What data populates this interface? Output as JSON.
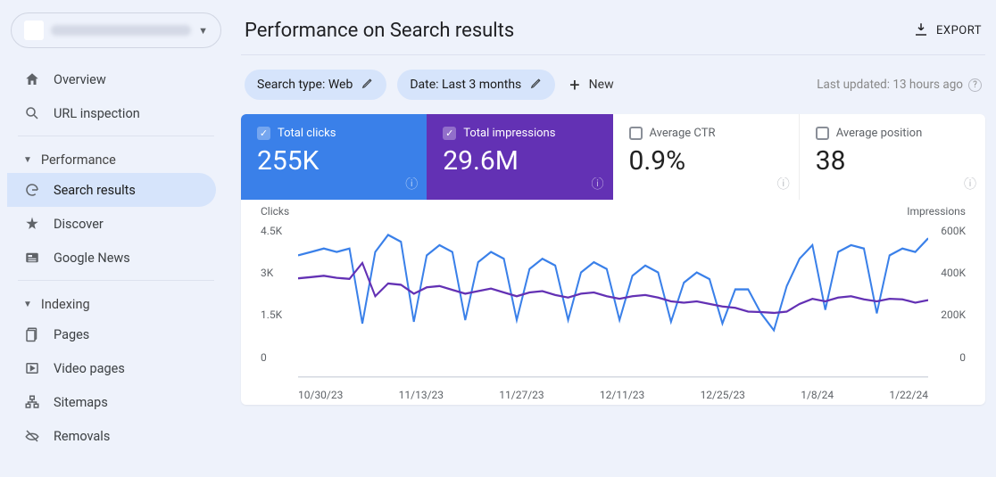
{
  "page_title": "Performance on Search results",
  "export_label": "EXPORT",
  "site_selector": {
    "open_label": "▼"
  },
  "sidebar": {
    "top": [
      {
        "label": "Overview",
        "icon": "home-icon"
      },
      {
        "label": "URL inspection",
        "icon": "search-icon"
      }
    ],
    "sections": [
      {
        "name": "Performance",
        "items": [
          {
            "label": "Search results",
            "icon": "google-icon",
            "active": true
          },
          {
            "label": "Discover",
            "icon": "star-icon"
          },
          {
            "label": "Google News",
            "icon": "news-icon"
          }
        ]
      },
      {
        "name": "Indexing",
        "items": [
          {
            "label": "Pages",
            "icon": "pages-icon"
          },
          {
            "label": "Video pages",
            "icon": "video-pages-icon"
          },
          {
            "label": "Sitemaps",
            "icon": "sitemaps-icon"
          },
          {
            "label": "Removals",
            "icon": "removals-icon"
          }
        ]
      }
    ]
  },
  "filters": {
    "search_type": "Search type: Web",
    "date": "Date: Last 3 months",
    "new_label": "New"
  },
  "last_updated": "Last updated: 13 hours ago",
  "metrics": {
    "clicks": {
      "label": "Total clicks",
      "value": "255K",
      "checked": true
    },
    "impressions": {
      "label": "Total impressions",
      "value": "29.6M",
      "checked": true
    },
    "ctr": {
      "label": "Average CTR",
      "value": "0.9%",
      "checked": false
    },
    "position": {
      "label": "Average position",
      "value": "38",
      "checked": false
    }
  },
  "chart_labels": {
    "left_title": "Clicks",
    "right_title": "Impressions",
    "left_ticks": [
      "4.5K",
      "3K",
      "1.5K",
      "0"
    ],
    "right_ticks": [
      "600K",
      "400K",
      "200K",
      "0"
    ],
    "x_ticks": [
      "10/30/23",
      "11/13/23",
      "11/27/23",
      "12/11/23",
      "12/25/23",
      "1/8/24",
      "1/22/24"
    ]
  },
  "chart_data": {
    "type": "line",
    "x": [
      "10/23/23",
      "10/25/23",
      "10/27/23",
      "10/29/23",
      "10/31/23",
      "11/02/23",
      "11/04/23",
      "11/06/23",
      "11/08/23",
      "11/10/23",
      "11/12/23",
      "11/14/23",
      "11/16/23",
      "11/18/23",
      "11/20/23",
      "11/22/23",
      "11/24/23",
      "11/26/23",
      "11/28/23",
      "11/30/23",
      "12/02/23",
      "12/04/23",
      "12/06/23",
      "12/08/23",
      "12/10/23",
      "12/12/23",
      "12/14/23",
      "12/16/23",
      "12/18/23",
      "12/20/23",
      "12/22/23",
      "12/24/23",
      "12/26/23",
      "12/28/23",
      "12/30/23",
      "01/01/24",
      "01/03/24",
      "01/05/24",
      "01/07/24",
      "01/09/24",
      "01/11/24",
      "01/13/24",
      "01/15/24",
      "01/17/24",
      "01/19/24",
      "01/21/24",
      "01/23/24",
      "01/25/24",
      "01/27/24",
      "01/29/24"
    ],
    "series": [
      {
        "name": "Clicks",
        "axis": "left",
        "color": "#3a80e9",
        "ylim": [
          0,
          4500
        ],
        "values": [
          3600,
          3700,
          3800,
          3700,
          3800,
          1600,
          3700,
          4200,
          4000,
          1650,
          3600,
          3900,
          3700,
          1700,
          3400,
          3700,
          3500,
          1700,
          3200,
          3500,
          3300,
          1700,
          3100,
          3400,
          3200,
          1700,
          3000,
          3300,
          3100,
          1650,
          2800,
          3100,
          2900,
          1600,
          2600,
          2600,
          1900,
          1400,
          2700,
          3500,
          3900,
          2000,
          3700,
          3900,
          3800,
          1900,
          3600,
          3800,
          3700,
          4100
        ]
      },
      {
        "name": "Impressions",
        "axis": "right",
        "color": "#6331b4",
        "ylim": [
          0,
          600000
        ],
        "values": [
          390000,
          395000,
          400000,
          392000,
          388000,
          450000,
          320000,
          370000,
          365000,
          330000,
          355000,
          360000,
          345000,
          330000,
          340000,
          350000,
          335000,
          320000,
          335000,
          340000,
          325000,
          315000,
          330000,
          335000,
          320000,
          310000,
          320000,
          325000,
          315000,
          300000,
          295000,
          300000,
          290000,
          280000,
          275000,
          260000,
          258000,
          255000,
          260000,
          290000,
          310000,
          300000,
          315000,
          320000,
          308000,
          300000,
          310000,
          308000,
          295000,
          305000
        ]
      }
    ]
  }
}
